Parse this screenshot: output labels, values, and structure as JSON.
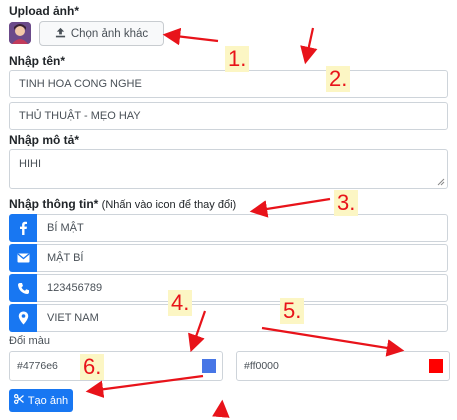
{
  "upload": {
    "label": "Upload ảnh*",
    "choose_button": "Chọn ảnh khác"
  },
  "name": {
    "label": "Nhập tên*",
    "line1": "TINH HOA CONG NGHE",
    "line2": "THỦ THUẬT - MẸO HAY"
  },
  "description": {
    "label": "Nhập mô tả*",
    "value": "HIHI"
  },
  "info": {
    "label": "Nhập thông tin*",
    "note": "(Nhấn vào icon để thay đổi)",
    "fields": [
      {
        "icon": "facebook-icon",
        "value": "BÍ MẬT"
      },
      {
        "icon": "mail-icon",
        "value": "MẬT BÍ"
      },
      {
        "icon": "phone-icon",
        "value": "123456789"
      },
      {
        "icon": "location-icon",
        "value": "VIET NAM"
      }
    ]
  },
  "colors": {
    "label": "Đổi màu",
    "color1": {
      "value": "#4776e6",
      "swatch": "#4776e6"
    },
    "color2": {
      "value": "#ff0000",
      "swatch": "#ff0000"
    }
  },
  "create_button": "Tạo ảnh",
  "annotations": [
    "1.",
    "2.",
    "3.",
    "4.",
    "5.",
    "6."
  ],
  "accent_color": "#1877f2",
  "annotation_color": "#e8131a"
}
